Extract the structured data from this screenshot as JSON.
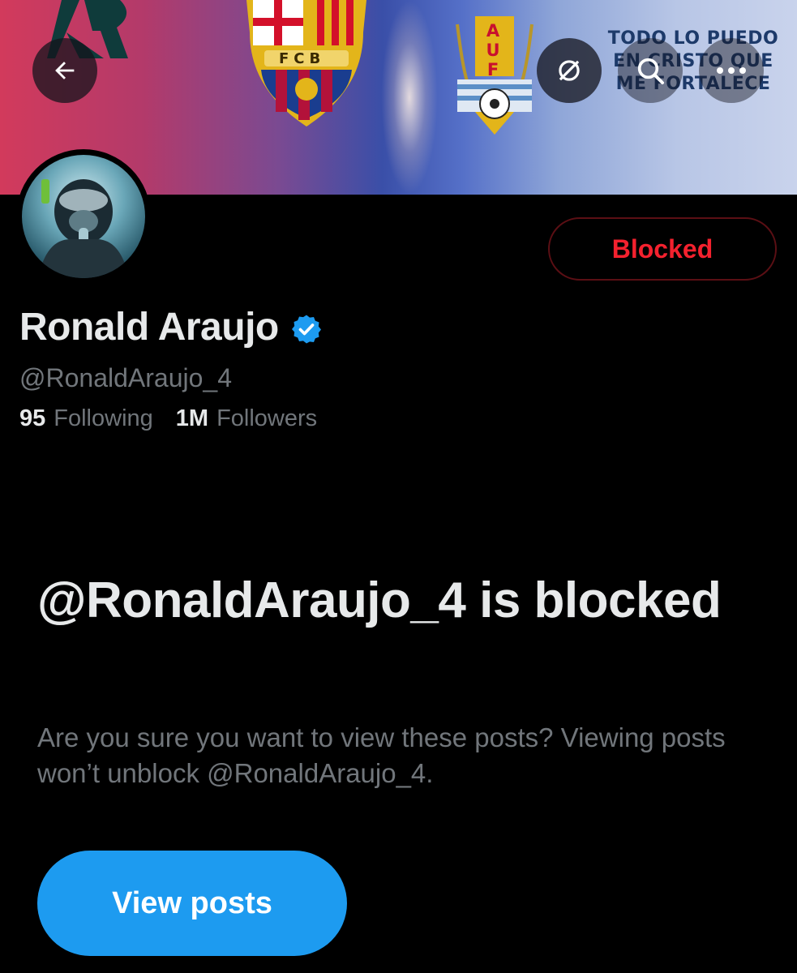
{
  "banner": {
    "crest_fcb_text": "FCB",
    "crest_auf_text": "AUF",
    "motto_line1": "TODO LO PUEDO",
    "motto_line2": "EN CRISTO QUE",
    "motto_line3": "ME FORTALECE"
  },
  "header": {
    "back_icon": "back-arrow-icon",
    "nolink_icon": "link-off-icon",
    "search_icon": "search-icon",
    "more_icon": "more-icon",
    "more_label": "..."
  },
  "profile": {
    "display_name": "Ronald Araujo",
    "verified_icon": "verified-badge-icon",
    "handle": "@RonaldAraujo_4",
    "following_count": "95",
    "following_label": "Following",
    "followers_count": "1M",
    "followers_label": "Followers",
    "blocked_button_label": "Blocked"
  },
  "blocked_notice": {
    "title": "@RonaldArauj​o_4 is blocked",
    "description": "Are you sure you want to view these posts? Viewing posts won’t unblock @RonaldAraujo_4.",
    "view_posts_label": "View posts"
  },
  "colors": {
    "background": "#000000",
    "accent_blue": "#1d9bf0",
    "blocked_red": "#f4212e",
    "primary_text": "#e7e9ea",
    "secondary_text": "#71767b"
  }
}
